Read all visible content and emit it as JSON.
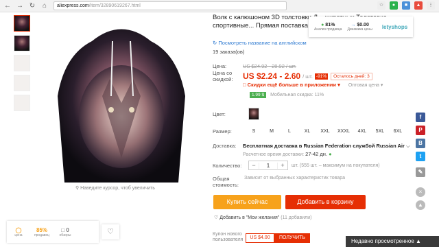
{
  "browser": {
    "url_host": "aliexpress.com",
    "url_path": "/item/32890619267.html"
  },
  "title": "Волк с капюшоном 3D толстовки Д... животных Толстовка, спортивные... Прямая поставка ZOOTOPBEAR",
  "translate_link": "Посмотреть название на английском",
  "orders": "19 заказа(ов)",
  "price": {
    "label_price": "Цена:",
    "old": "US $24.92 - 28.92 / шт.",
    "label_discount": "Цена со скидкой:",
    "current": "US $2.24 - 2.60",
    "unit": "/ шт.",
    "discount": "-91%",
    "days_left": "Осталось дней: 3",
    "app_discount": "Скидки ещё больше в приложении",
    "wholesale": "Оптовая цена",
    "mobile_badge": "1.99 $",
    "mobile_text": "Мобильная скидка: 11%"
  },
  "color_label": "Цвет:",
  "size_label": "Размер:",
  "sizes": [
    "S",
    "M",
    "L",
    "XL",
    "XXL",
    "XXXL",
    "4XL",
    "5XL",
    "6XL"
  ],
  "shipping": {
    "label": "Доставка:",
    "main": "Бесплатная доставка в Russian Federation службой Russian Air",
    "sub": "Расчетное время доставки:",
    "days": "27-42 дн."
  },
  "quantity": {
    "label": "Количество:",
    "value": "1",
    "note": "шт. (555 шт. – максимум на покупателя)"
  },
  "total": {
    "label": "Общая стоимость:",
    "note": "Зависит от выбранных характеристик товара"
  },
  "buttons": {
    "buy_now": "Купить сейчас",
    "add_cart": "Добавить в корзину"
  },
  "wishlist": {
    "text": "Добавить в \"Мои желания\"",
    "count": "(11 добавили)"
  },
  "coupon": {
    "label": "Купон нового пользователя",
    "value": "US $4.00",
    "button": "ПОЛУЧИТЬ"
  },
  "zoom_hint": "Наведите курсор, чтоб увеличить",
  "lety": {
    "percent": "81%",
    "percent_sub": "Анализ продавца",
    "cashback": "$0.00",
    "cashback_sub": "Динамика цены",
    "brand": "letyshops"
  },
  "mini_widget": {
    "icon_label": "цена",
    "rating": "85%",
    "rating_sub": "продавец",
    "reviews": "0",
    "reviews_sub": "обзоры"
  },
  "recently_viewed": "Недавно просмотренное",
  "colors": {
    "accent": "#e62e04",
    "buy": "#f7a21b",
    "link": "#2e7ad1"
  }
}
